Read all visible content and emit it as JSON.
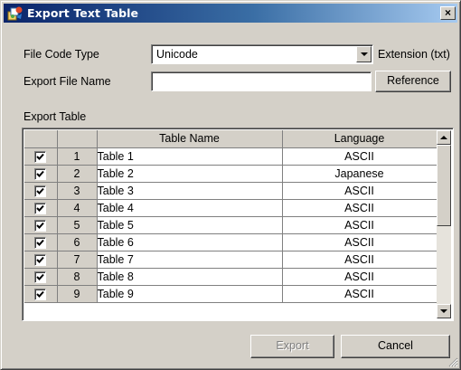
{
  "window": {
    "title": "Export Text Table",
    "close_glyph": "×"
  },
  "form": {
    "file_code_type_label": "File Code Type",
    "file_code_type_value": "Unicode",
    "extension_label": "Extension (txt)",
    "export_file_name_label": "Export File Name",
    "export_file_name_value": "",
    "reference_button": "Reference",
    "export_table_label": "Export Table"
  },
  "table": {
    "columns": [
      "",
      "",
      "Table Name",
      "Language"
    ],
    "rows": [
      {
        "checked": true,
        "num": "1",
        "name": "Table 1",
        "language": "ASCII"
      },
      {
        "checked": true,
        "num": "2",
        "name": "Table 2",
        "language": "Japanese"
      },
      {
        "checked": true,
        "num": "3",
        "name": "Table 3",
        "language": "ASCII"
      },
      {
        "checked": true,
        "num": "4",
        "name": "Table 4",
        "language": "ASCII"
      },
      {
        "checked": true,
        "num": "5",
        "name": "Table 5",
        "language": "ASCII"
      },
      {
        "checked": true,
        "num": "6",
        "name": "Table 6",
        "language": "ASCII"
      },
      {
        "checked": true,
        "num": "7",
        "name": "Table 7",
        "language": "ASCII"
      },
      {
        "checked": true,
        "num": "8",
        "name": "Table 8",
        "language": "ASCII"
      },
      {
        "checked": true,
        "num": "9",
        "name": "Table 9",
        "language": "ASCII"
      }
    ]
  },
  "buttons": {
    "export": "Export",
    "export_enabled": false,
    "cancel": "Cancel"
  },
  "icons": {
    "app": "app-icon",
    "checkbox": "checkmark-icon",
    "scroll_up": "arrow-up-icon",
    "scroll_down": "arrow-down-icon",
    "dropdown": "chevron-down-icon",
    "resize": "resize-grip-icon"
  },
  "colors": {
    "titlebar_start": "#0a246a",
    "titlebar_end": "#a6caf0",
    "face": "#d4d0c8"
  }
}
